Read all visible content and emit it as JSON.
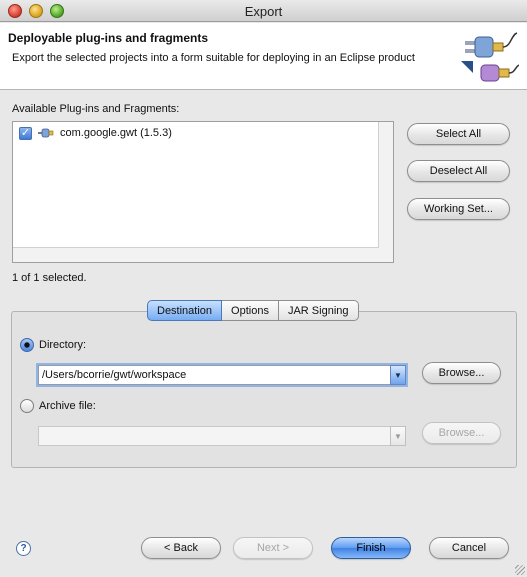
{
  "window": {
    "title": "Export"
  },
  "banner": {
    "title": "Deployable plug-ins and fragments",
    "description": "Export the selected projects into a form suitable for deploying in an Eclipse product",
    "icon": "plugin-export-wizard-icon"
  },
  "plugins": {
    "label": "Available Plug-ins and Fragments:",
    "items": [
      {
        "name": "com.google.gwt (1.5.3)",
        "checked": true,
        "icon": "plugin-icon"
      }
    ],
    "selection_status": "1 of 1 selected."
  },
  "side_buttons": {
    "select_all": "Select All",
    "deselect_all": "Deselect All",
    "working_set": "Working Set..."
  },
  "tabs": {
    "items": [
      "Destination",
      "Options",
      "JAR Signing"
    ],
    "active": "Destination"
  },
  "destination": {
    "directory_label": "Directory:",
    "directory_value": "/Users/bcorrie/gwt/workspace",
    "directory_selected": true,
    "archive_label": "Archive file:",
    "archive_value": "",
    "browse_label": "Browse..."
  },
  "footer": {
    "back": "< Back",
    "next": "Next >",
    "finish": "Finish",
    "cancel": "Cancel",
    "help_icon": "help-icon"
  },
  "colors": {
    "accent": "#3f82e3",
    "window_bg": "#e8e8e8"
  }
}
